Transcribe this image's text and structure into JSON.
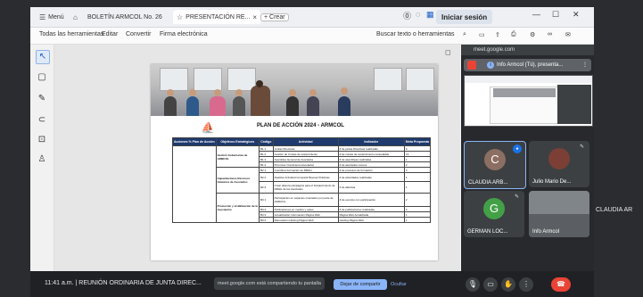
{
  "tabs": [
    {
      "label": "Menú",
      "icon": "grid-icon"
    },
    {
      "label": "BOLETÍN ARMCOL No. 26",
      "icon": "home-icon"
    },
    {
      "label": "PRESENTACIÓN RE...",
      "icon": "star-icon"
    }
  ],
  "new_tab_label": "Crear",
  "sign_in_label": "Iniciar sesión",
  "toolbar": {
    "items": [
      "Todas las herramientas",
      "Editar",
      "Convertir",
      "Firma electrónica"
    ],
    "search_label": "Buscar texto o herramientas"
  },
  "document": {
    "title": "PLAN DE ACCIÓN 2024 - ARMCOL",
    "headers": [
      "Acciones % Plan de Acción",
      "Objetivos Estratégicos",
      "Código",
      "Actividad",
      "Indicador",
      "Meta Propuesta"
    ],
    "objectives": [
      "Gestión Gobernanza de ARMCOL",
      "Capacitaciones Recursos Humanos de Asociados",
      "Promoción y visibilización de la Asociación"
    ],
    "rows": [
      {
        "code": "B1.1",
        "activity": "Juntas Directivas",
        "indicator": "# de juntas Directivas realizadas",
        "target": "6"
      },
      {
        "code": "B1.2",
        "activity": "Gestión de Cuotas de sostenimiento",
        "indicator": "# de cuotas de sostenimiento recaudadas",
        "target": "13"
      },
      {
        "code": "B1.3",
        "activity": "Asamblea General de Asociados",
        "indicator": "# de asambleas realizadas",
        "target": "1"
      },
      {
        "code": "B1.4",
        "activity": "Promover Crecimiento Asociados",
        "indicator": "# de asociados nuevos",
        "target": "2"
      },
      {
        "code": "B2.1",
        "activity": "Coordinar Formación de RRHH",
        "indicator": "# de procesos de formación",
        "target": "3"
      },
      {
        "code": "B2.2",
        "activity": "Realizar Actividad Compartir Buenas Prácticas",
        "indicator": "# de actividades realizadas",
        "target": "1"
      },
      {
        "code": "B2.3",
        "activity": "Crear alianza estratégica para el fortalecimiento de RRHH de los Asociados",
        "indicator": "# de alianzas",
        "target": "1"
      },
      {
        "code": "B3.1",
        "activity": "Participación en espacios orientados por parte de ARMCOL",
        "indicator": "# de eventos con participación",
        "target": "2"
      },
      {
        "code": "B3.2",
        "activity": "Publicaciones en medios y redes",
        "indicator": "# de publicaciones realizadas",
        "target": "4"
      },
      {
        "code": "B3.3",
        "activity": "Actualización Información Página Web",
        "indicator": "Página Web Actualizada",
        "target": "1"
      },
      {
        "code": "B3.4",
        "activity": "Renovación Hosting Página Web",
        "indicator": "Hosting Página Web",
        "target": "1"
      }
    ]
  },
  "meet": {
    "url": "meet.google.com",
    "presenting_label": "Info Armcol (Tú), presenta...",
    "participants": [
      {
        "name": "CLAUDIA ARB...",
        "initial": "C",
        "color": "#8d6e63"
      },
      {
        "name": "Julio Mario De...",
        "initial": "",
        "color": "#5f6368"
      },
      {
        "name": "GERMAN LOC...",
        "initial": "G",
        "color": "#43a047"
      },
      {
        "name": "Info Armcol",
        "initial": "",
        "color": "#5f6368"
      }
    ],
    "side_label": "CLAUDIA AR"
  },
  "bottom": {
    "time": "11:41 a.m.",
    "meeting_title": "REUNIÓN ORDINARIA DE JUNTA DIREC...",
    "share_text": "meet.google.com está compartiendo tu pantalla",
    "stop_label": "Dejar de compartir",
    "hide_label": "Ocultar"
  },
  "colors": {
    "accent": "#1e3a6e",
    "meet_bg": "#202124",
    "stop_blue": "#8ab4f8",
    "end_call": "#ea4335"
  }
}
